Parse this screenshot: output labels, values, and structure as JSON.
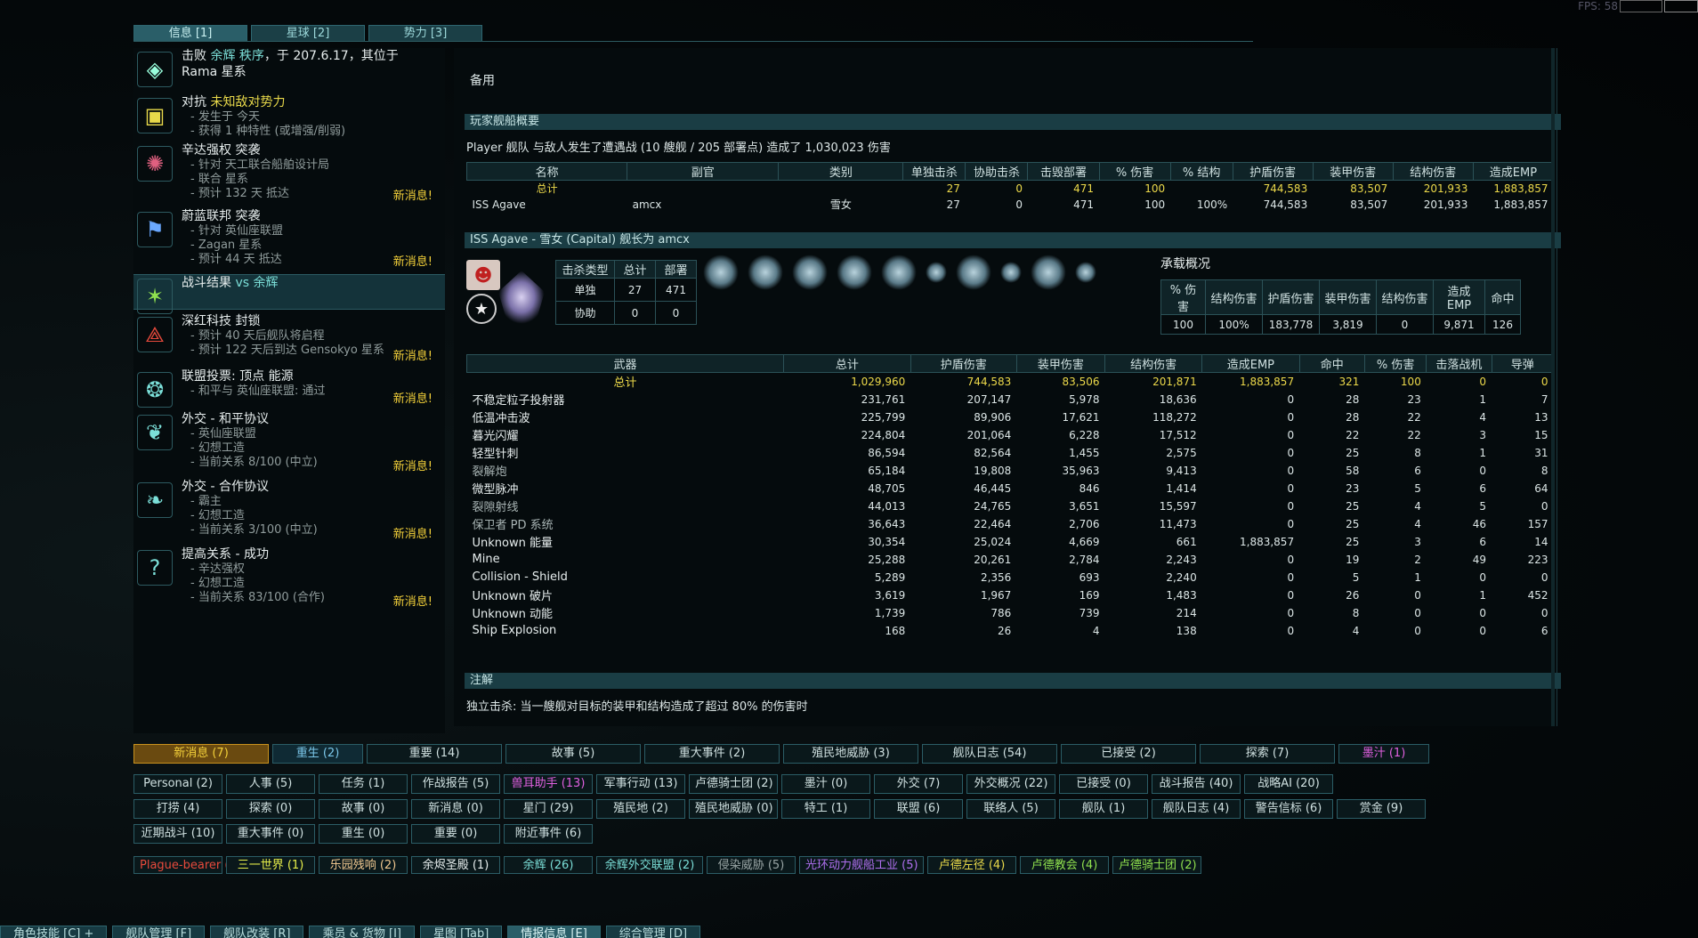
{
  "fps": {
    "label": "FPS:",
    "value": "58"
  },
  "top_tabs": [
    {
      "label": "信息 [1]"
    },
    {
      "label": "星球 [2]"
    },
    {
      "label": "势力 [3]"
    }
  ],
  "events": [
    {
      "icon": "shield-icon",
      "title_parts": [
        "击败 ",
        "余辉 秩序",
        "，于 207.6.17，其位于"
      ],
      "line2": "Rama 星系",
      "lines": [],
      "new": ""
    },
    {
      "icon": "document-icon",
      "title_parts": [
        "对抗 ",
        "未知敌对势力",
        ""
      ],
      "lines": [
        "发生于 今天",
        "获得 1 种特性 (或增强/削弱)"
      ],
      "new": ""
    },
    {
      "icon": "tritachyon-icon",
      "title_parts": [
        "辛达强权 突袭",
        "",
        ""
      ],
      "lines": [
        "针对 天工联合船舶设计局",
        "联合 星系",
        "预计 132 天 抵达"
      ],
      "new": "新消息!"
    },
    {
      "icon": "flag-icon",
      "title_parts": [
        "蔚蓝联邦 突袭",
        "",
        ""
      ],
      "lines": [
        "针对 英仙座联盟",
        "Zagan 星系",
        "预计 44 天 抵达"
      ],
      "new": "新消息!"
    },
    {
      "icon": "battle-icon",
      "title_parts": [
        "战斗结果 ",
        "vs 余辉",
        ""
      ],
      "lines": [],
      "new": ""
    },
    {
      "icon": "blockade-icon",
      "title_parts": [
        "深红科技 封锁",
        "",
        ""
      ],
      "lines": [
        "预计 40 天后舰队将启程",
        "预计 122 天后到达 Gensokyo 星系"
      ],
      "new": "新消息!"
    },
    {
      "icon": "vote-icon",
      "title_parts": [
        "联盟投票: 顶点 能源",
        "",
        ""
      ],
      "lines": [
        "和平与 英仙座联盟: 通过"
      ],
      "new": "新消息!"
    },
    {
      "icon": "laurel-icon",
      "title_parts": [
        "外交 - 和平协议",
        "",
        ""
      ],
      "lines": [
        "英仙座联盟",
        "幻想工造",
        "当前关系 8/100 (中立)"
      ],
      "new": "新消息!"
    },
    {
      "icon": "leaf-icon",
      "title_parts": [
        "外交 - 合作协议",
        "",
        ""
      ],
      "lines": [
        "霸主",
        "幻想工造",
        "当前关系 3/100 (中立)"
      ],
      "new": "新消息!"
    },
    {
      "icon": "question-icon",
      "title_parts": [
        "提高关系 - 成功",
        "",
        ""
      ],
      "lines": [
        "辛达强权",
        "幻想工造",
        "当前关系 83/100 (合作)"
      ],
      "new": "新消息!"
    }
  ],
  "right": {
    "title": "备用",
    "summary_header": "玩家舰船概要",
    "summary_line": "Player 舰队 与敌人发生了遭遇战 (10 艘舰 / 205 部署点) 造成了 1,030,023 伤害",
    "t1_headers": [
      "名称",
      "副官",
      "类别",
      "单独击杀",
      "协助击杀",
      "击毁部署",
      "% 伤害",
      "% 结构",
      "护盾伤害",
      "装甲伤害",
      "结构伤害",
      "造成EMP"
    ],
    "t1_rows": [
      {
        "cells": [
          "总计",
          "",
          "",
          "27",
          "0",
          "471",
          "100",
          "",
          "744,583",
          "83,507",
          "201,933",
          "1,883,857"
        ],
        "total": true
      },
      {
        "cells": [
          "ISS Agave",
          "amcx",
          "雪女",
          "27",
          "0",
          "471",
          "100",
          "100%",
          "744,583",
          "83,507",
          "201,933",
          "1,883,857"
        ],
        "total": false
      }
    ],
    "ship_header": "ISS Agave - 雪女 (Capital) 舰长为 amcx",
    "kill_headers": [
      "击杀类型",
      "总计",
      "部署"
    ],
    "kill_rows": [
      [
        "单独",
        "27",
        "471"
      ],
      [
        "协助",
        "0",
        "0"
      ]
    ],
    "carrier_title": "承载概况",
    "carrier_headers": [
      "% 伤害",
      "结构伤害",
      "护盾伤害",
      "装甲伤害",
      "结构伤害",
      "造成EMP",
      "命中"
    ],
    "carrier_row": [
      "100",
      "100%",
      "183,778",
      "3,819",
      "0",
      "9,871",
      "126"
    ],
    "w_headers": [
      "武器",
      "总计",
      "护盾伤害",
      "装甲伤害",
      "结构伤害",
      "造成EMP",
      "命中",
      "% 伤害",
      "击落战机",
      "导弹"
    ],
    "w_rows": [
      {
        "cells": [
          "总计",
          "1,029,960",
          "744,583",
          "83,506",
          "201,871",
          "1,883,857",
          "321",
          "100",
          "0",
          "0"
        ],
        "total": true
      },
      {
        "cells": [
          "不稳定粒子投射器",
          "231,761",
          "207,147",
          "5,978",
          "18,636",
          "0",
          "28",
          "23",
          "1",
          "7"
        ]
      },
      {
        "cells": [
          "低温冲击波",
          "225,799",
          "89,906",
          "17,621",
          "118,272",
          "0",
          "28",
          "22",
          "4",
          "13"
        ]
      },
      {
        "cells": [
          "暮光闪耀",
          "224,804",
          "201,064",
          "6,228",
          "17,512",
          "0",
          "22",
          "22",
          "3",
          "15"
        ]
      },
      {
        "cells": [
          "轻型针刺",
          "86,594",
          "82,564",
          "1,455",
          "2,575",
          "0",
          "25",
          "8",
          "1",
          "31"
        ]
      },
      {
        "cells": [
          "裂解炮",
          "65,184",
          "19,808",
          "35,963",
          "9,413",
          "0",
          "58",
          "6",
          "0",
          "8"
        ],
        "dim": true
      },
      {
        "cells": [
          "微型脉冲",
          "48,705",
          "46,445",
          "846",
          "1,414",
          "0",
          "23",
          "5",
          "6",
          "64"
        ]
      },
      {
        "cells": [
          "裂隙射线",
          "44,013",
          "24,765",
          "3,651",
          "15,597",
          "0",
          "25",
          "4",
          "5",
          "0"
        ],
        "dim": true
      },
      {
        "cells": [
          "保卫者 PD 系统",
          "36,643",
          "22,464",
          "2,706",
          "11,473",
          "0",
          "25",
          "4",
          "46",
          "157"
        ],
        "dim": true
      },
      {
        "cells": [
          "Unknown 能量",
          "30,354",
          "25,024",
          "4,669",
          "661",
          "1,883,857",
          "25",
          "3",
          "6",
          "14"
        ]
      },
      {
        "cells": [
          "Mine",
          "25,288",
          "20,261",
          "2,784",
          "2,243",
          "0",
          "19",
          "2",
          "49",
          "223"
        ]
      },
      {
        "cells": [
          "Collision - Shield",
          "5,289",
          "2,356",
          "693",
          "2,240",
          "0",
          "5",
          "1",
          "0",
          "0"
        ]
      },
      {
        "cells": [
          "Unknown 破片",
          "3,619",
          "1,967",
          "169",
          "1,483",
          "0",
          "26",
          "0",
          "1",
          "452"
        ]
      },
      {
        "cells": [
          "Unknown 动能",
          "1,739",
          "786",
          "739",
          "214",
          "0",
          "8",
          "0",
          "0",
          "0"
        ]
      },
      {
        "cells": [
          "Ship Explosion",
          "168",
          "26",
          "4",
          "138",
          "0",
          "4",
          "0",
          "0",
          "6"
        ]
      }
    ],
    "notes_header": "注解",
    "notes_line": "独立击杀: 当一艘舰对目标的装甲和结构造成了超过 80% 的伤害时"
  },
  "row1": [
    {
      "label": "新消息 (7)",
      "style": "hl",
      "w": 150
    },
    {
      "label": "重生 (2)",
      "style": "blue",
      "w": 100
    },
    {
      "label": "重要 (14)",
      "w": 150
    },
    {
      "label": "故事 (5)",
      "w": 150
    },
    {
      "label": "重大事件 (2)",
      "w": 150
    },
    {
      "label": "殖民地威胁 (3)",
      "w": 150
    },
    {
      "label": "舰队日志 (54)",
      "w": 150
    },
    {
      "label": "已接受 (2)",
      "w": 150
    },
    {
      "label": "探索 (7)",
      "w": 150
    },
    {
      "label": "墨汁 (1)",
      "style": "pink",
      "w": 100
    }
  ],
  "row2": [
    {
      "label": "Personal (2)",
      "w": 100
    },
    {
      "label": "人事 (5)",
      "w": 100
    },
    {
      "label": "任务 (1)",
      "w": 100
    },
    {
      "label": "作战报告 (5)",
      "w": 100
    },
    {
      "label": "兽耳助手 (13)",
      "style": "pink",
      "w": 100
    },
    {
      "label": "军事行动 (13)",
      "w": 100
    },
    {
      "label": "卢德骑士团 (2)",
      "w": 100
    },
    {
      "label": "墨汁 (0)",
      "w": 100
    },
    {
      "label": "外交 (7)",
      "w": 100
    },
    {
      "label": "外交概况 (22)",
      "w": 100
    },
    {
      "label": "已接受 (0)",
      "w": 100
    },
    {
      "label": "战斗报告 (40)",
      "w": 100
    },
    {
      "label": "战略AI (20)",
      "w": 100
    }
  ],
  "row3": [
    {
      "label": "打捞 (4)",
      "w": 100
    },
    {
      "label": "探索 (0)",
      "w": 100
    },
    {
      "label": "故事 (0)",
      "w": 100
    },
    {
      "label": "新消息 (0)",
      "w": 100
    },
    {
      "label": "星门 (29)",
      "w": 100
    },
    {
      "label": "殖民地 (2)",
      "w": 100
    },
    {
      "label": "殖民地威胁 (0)",
      "w": 100
    },
    {
      "label": "特工 (1)",
      "w": 100
    },
    {
      "label": "联盟 (6)",
      "w": 100
    },
    {
      "label": "联络人 (5)",
      "w": 100
    },
    {
      "label": "舰队 (1)",
      "w": 100
    },
    {
      "label": "舰队日志 (4)",
      "w": 100
    },
    {
      "label": "警告信标 (6)",
      "w": 100
    },
    {
      "label": "赏金 (9)",
      "w": 100
    }
  ],
  "row4": [
    {
      "label": "近期战斗 (10)",
      "w": 100
    },
    {
      "label": "重大事件 (0)",
      "w": 100
    },
    {
      "label": "重生 (0)",
      "w": 100
    },
    {
      "label": "重要 (0)",
      "w": 100
    },
    {
      "label": "附近事件 (6)",
      "w": 100
    }
  ],
  "row5": [
    {
      "label": "Plague-bearer (1)",
      "color": "#e84a3c",
      "w": 100
    },
    {
      "label": "三一世界 (1)",
      "color": "#e8f04a",
      "w": 100
    },
    {
      "label": "乐园残响 (2)",
      "color": "#f0c890",
      "w": 100
    },
    {
      "label": "余烬圣殿 (1)",
      "color": "#e7eeee",
      "w": 100
    },
    {
      "label": "余辉 (26)",
      "color": "#7bdfd8",
      "w": 100
    },
    {
      "label": "余辉外交联盟 (2)",
      "color": "#7bdfd8",
      "w": 120
    },
    {
      "label": "侵染威胁 (5)",
      "color": "#9aa6a6",
      "w": 100
    },
    {
      "label": "光环动力舰船工业 (5)",
      "color": "#b070f0",
      "w": 140
    },
    {
      "label": "卢德左径 (4)",
      "color": "#e8d94a",
      "w": 100
    },
    {
      "label": "卢德教会 (4)",
      "color": "#8fe04e",
      "w": 100
    },
    {
      "label": "卢德骑士团 (2)",
      "color": "#8fe04e",
      "w": 100
    }
  ],
  "bottom_tabs": [
    {
      "label": "角色技能 [C] +"
    },
    {
      "label": "舰队管理 [F]"
    },
    {
      "label": "舰队改装 [R]"
    },
    {
      "label": "乘员 & 货物 [I]"
    },
    {
      "label": "星图 [Tab]"
    },
    {
      "label": "情报信息 [E]"
    },
    {
      "label": "综合管理 [D]"
    }
  ]
}
